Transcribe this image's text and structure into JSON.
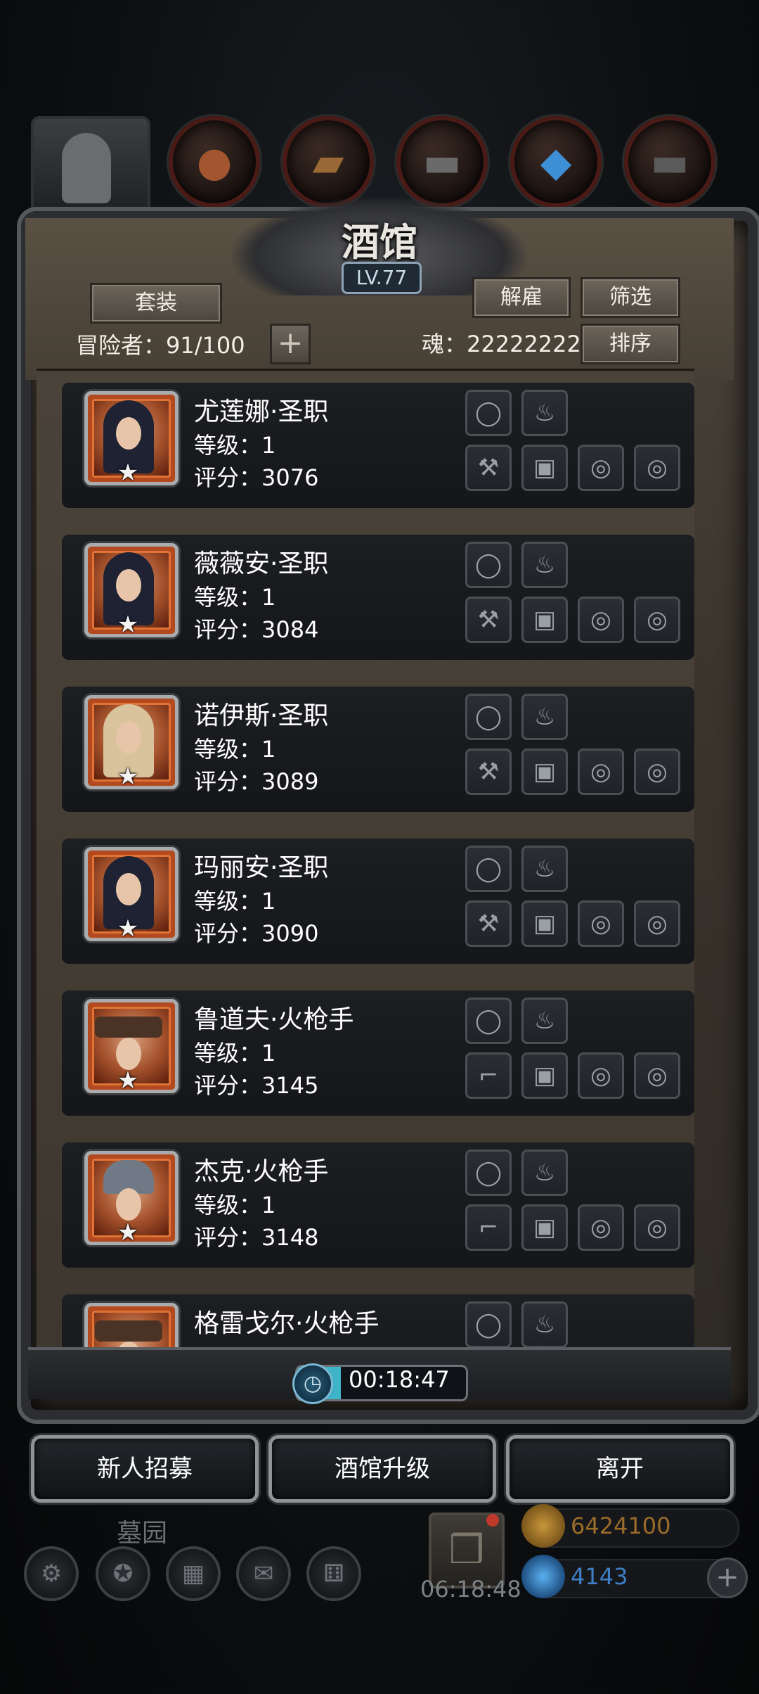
{
  "panel": {
    "title": "酒馆",
    "level": "LV.77"
  },
  "toolbar": {
    "set_label": "套装",
    "dismiss_label": "解雇",
    "filter_label": "筛选",
    "sort_label": "排序",
    "adventurers_label": "冒险者：91/100",
    "soul_label": "魂：22222222"
  },
  "heroes": [
    {
      "name": "尤莲娜·圣职",
      "level": "等级：1",
      "score": "评分：3076"
    },
    {
      "name": "薇薇安·圣职",
      "level": "等级：1",
      "score": "评分：3084"
    },
    {
      "name": "诺伊斯·圣职",
      "level": "等级：1",
      "score": "评分：3089"
    },
    {
      "name": "玛丽安·圣职",
      "level": "等级：1",
      "score": "评分：3090"
    },
    {
      "name": "鲁道夫·火枪手",
      "level": "等级：1",
      "score": "评分：3145"
    },
    {
      "name": "杰克·火枪手",
      "level": "等级：1",
      "score": "评分：3148"
    },
    {
      "name": "格雷戈尔·火枪手",
      "level": "",
      "score": ""
    }
  ],
  "timer": {
    "text": "00:18:47"
  },
  "actions": {
    "recruit_label": "新人招募",
    "upgrade_label": "酒馆升级",
    "leave_label": "离开"
  },
  "hud": {
    "location_label": "墓园",
    "gift_timer": "06:18:48",
    "gold_value": "6424100",
    "gem_value": "4143"
  },
  "colors": {
    "accent_gold": "#c9a04a",
    "accent_blue": "#4b8fd8",
    "frame_brown": "#3d372f"
  }
}
